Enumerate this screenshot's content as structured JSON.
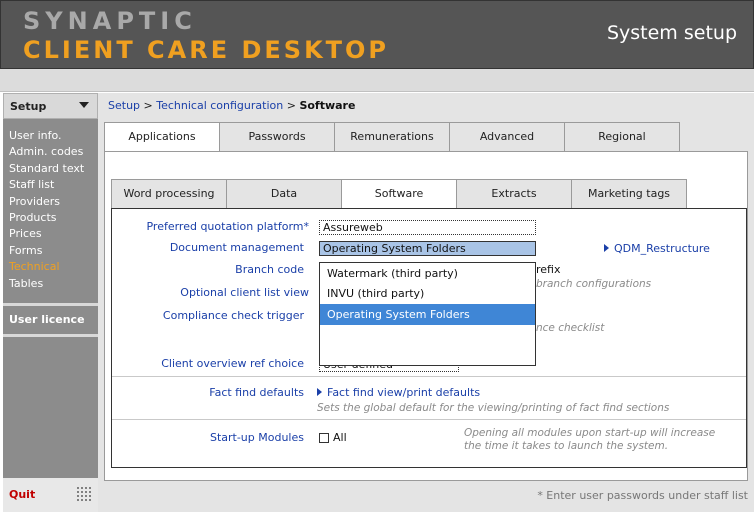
{
  "header": {
    "brand_line1": "SYNAPTIC",
    "brand_line2": "CLIENT CARE DESKTOP",
    "title": "System setup"
  },
  "sidebar": {
    "section_label": "Setup",
    "items": [
      {
        "label": "User info.",
        "active": false
      },
      {
        "label": "Admin. codes",
        "active": false
      },
      {
        "label": "Standard text",
        "active": false
      },
      {
        "label": "Staff list",
        "active": false
      },
      {
        "label": "Providers",
        "active": false
      },
      {
        "label": "Products",
        "active": false
      },
      {
        "label": "Prices",
        "active": false
      },
      {
        "label": "Forms",
        "active": false
      },
      {
        "label": "Technical",
        "active": true
      },
      {
        "label": "Tables",
        "active": false
      }
    ],
    "licence_label": "User licence",
    "quit_label": "Quit"
  },
  "breadcrumb": {
    "part1": "Setup",
    "sep1": " > ",
    "part2": "Technical configuration",
    "sep2": " > ",
    "current": "Software"
  },
  "tabs_primary": [
    {
      "label": "Applications",
      "active": true
    },
    {
      "label": "Passwords",
      "active": false
    },
    {
      "label": "Remunerations",
      "active": false
    },
    {
      "label": "Advanced",
      "active": false
    },
    {
      "label": "Regional",
      "active": false
    }
  ],
  "tabs_secondary": [
    {
      "label": "Word processing",
      "active": false
    },
    {
      "label": "Data",
      "active": false
    },
    {
      "label": "Software",
      "active": true
    },
    {
      "label": "Extracts",
      "active": false
    },
    {
      "label": "Marketing tags",
      "active": false
    }
  ],
  "form": {
    "quotation_label": "Preferred quotation platform*",
    "quotation_value": "Assureweb",
    "docmgmt_label": "Document management",
    "docmgmt_value": "Operating System Folders",
    "docmgmt_link": "QDM_Restructure",
    "branch_label": "Branch code",
    "branch_prefix_fragment": "refix",
    "branch_hint_fragment": "branch configurations",
    "clientlist_label": "Optional client list view",
    "compliance_label": "Compliance check trigger",
    "compliance_hint_fragment": "nce checklist",
    "overview_label": "Client overview ref choice",
    "overview_value": "User defined",
    "factfind_label": "Fact find defaults",
    "factfind_link": "Fact find view/print defaults",
    "factfind_hint": "Sets the global default for the viewing/printing of fact find sections",
    "startup_label": "Start-up Modules",
    "startup_checkbox_label": "All",
    "startup_checked": false,
    "startup_hint_line1": "Opening all modules upon start-up will increase",
    "startup_hint_line2": "the time it takes to launch the system."
  },
  "dropdown": {
    "options": [
      {
        "label": "Watermark (third party)",
        "highlighted": false
      },
      {
        "label": "INVU (third party)",
        "highlighted": false
      },
      {
        "label": "Operating System Folders",
        "highlighted": true
      }
    ]
  },
  "footnote": "* Enter user passwords under staff list",
  "colors": {
    "header_bg": "#555555",
    "brand_gray": "#a9a9a9",
    "brand_orange": "#f0a020",
    "link_blue": "#1a3fa8",
    "selected_blue": "#3f86d6",
    "quit_red": "#c00000"
  }
}
